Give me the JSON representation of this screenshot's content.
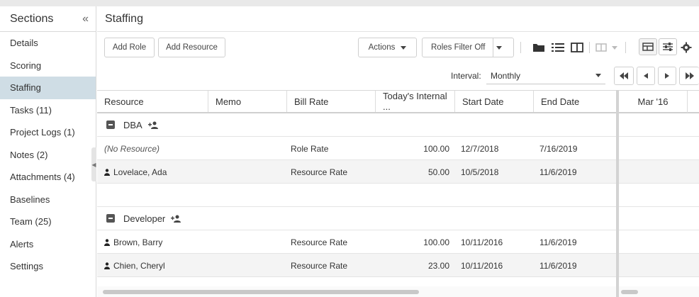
{
  "sidebar": {
    "title": "Sections",
    "collapse_icon": "«",
    "items": [
      {
        "label": "Details"
      },
      {
        "label": "Scoring"
      },
      {
        "label": "Staffing"
      },
      {
        "label": "Tasks (11)"
      },
      {
        "label": "Project Logs (1)"
      },
      {
        "label": "Notes (2)"
      },
      {
        "label": "Attachments (4)"
      },
      {
        "label": "Baselines"
      },
      {
        "label": "Team (25)"
      },
      {
        "label": "Alerts"
      },
      {
        "label": "Settings"
      }
    ]
  },
  "page": {
    "title": "Staffing"
  },
  "toolbar": {
    "add_role": "Add Role",
    "add_resource": "Add Resource",
    "actions": "Actions",
    "roles_filter": "Roles Filter Off"
  },
  "interval": {
    "label": "Interval:",
    "value": "Monthly"
  },
  "columns": [
    "Resource",
    "Memo",
    "Bill Rate",
    "Today's Internal ...",
    "Start Date",
    "End Date"
  ],
  "timeline": {
    "month": "Mar '16"
  },
  "groups": {
    "dba": "DBA",
    "developer": "Developer"
  },
  "rows": {
    "r1": {
      "resource": "(No Resource)",
      "bill_rate": "Role Rate",
      "rate": "100.00",
      "start": "12/7/2018",
      "end": "7/16/2019"
    },
    "r2": {
      "resource": "Lovelace, Ada",
      "bill_rate": "Resource Rate",
      "rate": "50.00",
      "start": "10/5/2018",
      "end": "11/6/2019"
    },
    "r3": {
      "resource": "Brown, Barry",
      "bill_rate": "Resource Rate",
      "rate": "100.00",
      "start": "10/11/2016",
      "end": "11/6/2019"
    },
    "r4": {
      "resource": "Chien, Cheryl",
      "bill_rate": "Resource Rate",
      "rate": "23.00",
      "start": "10/11/2016",
      "end": "11/6/2019"
    }
  },
  "colors": {
    "active_bg": "#cfdde5",
    "alt_row": "#f4f4f4",
    "icon_dark": "#333333"
  }
}
